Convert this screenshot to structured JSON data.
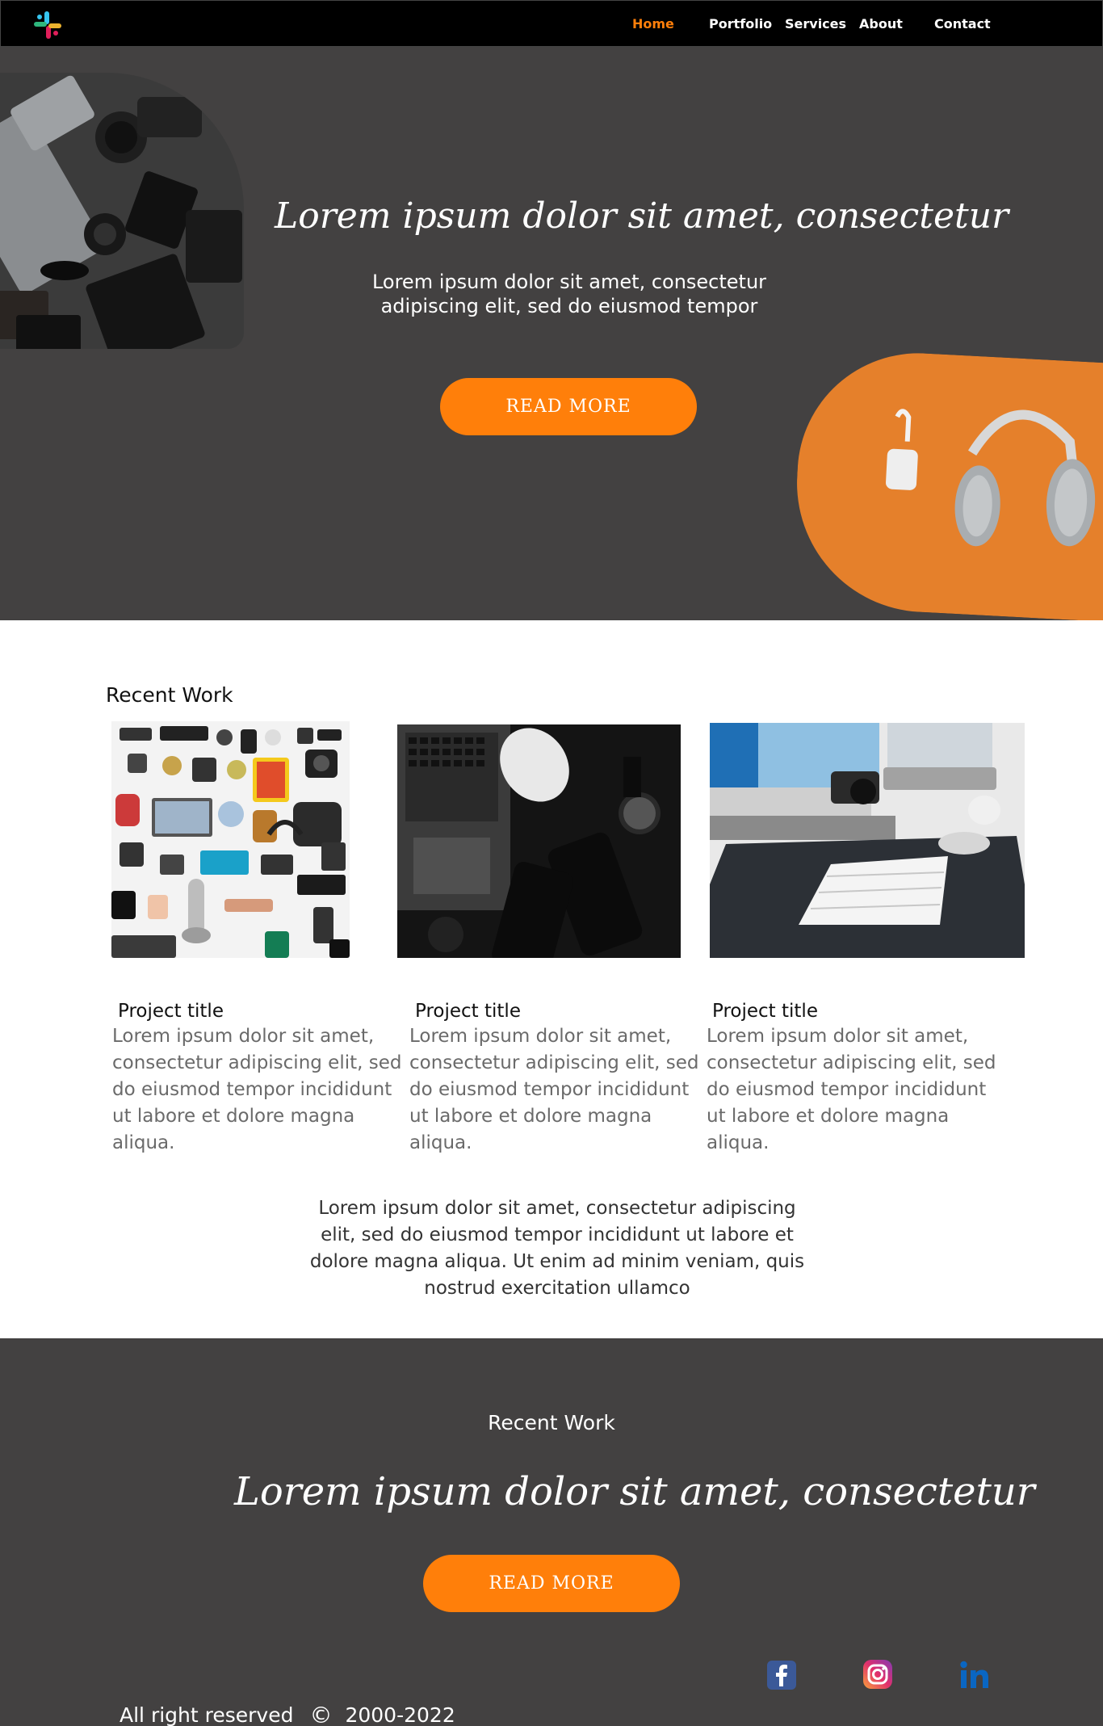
{
  "nav": {
    "items": [
      {
        "label": "Home",
        "active": true
      },
      {
        "label": "Portfolio",
        "active": false
      },
      {
        "label": "Services",
        "active": false
      },
      {
        "label": "About",
        "active": false
      },
      {
        "label": "Contact",
        "active": false
      }
    ]
  },
  "hero": {
    "title": "Lorem ipsum dolor sit amet, consectetur",
    "subtitle_line1": "Lorem ipsum dolor sit amet, consectetur",
    "subtitle_line2": "adipiscing elit, sed do eiusmod tempor",
    "button_label": "READ MORE"
  },
  "recent_work": {
    "heading": "Recent Work",
    "cards": [
      {
        "title": "Project title",
        "text": "Lorem ipsum dolor sit amet, consectetur adipiscing elit, sed do eiusmod tempor incididunt ut labore et dolore magna aliqua."
      },
      {
        "title": "Project title",
        "text": "Lorem ipsum dolor sit amet, consectetur adipiscing elit, sed do eiusmod tempor incididunt ut labore et dolore magna aliqua."
      },
      {
        "title": "Project title",
        "text": "Lorem ipsum dolor sit amet, consectetur adipiscing elit, sed do eiusmod tempor incididunt ut labore et dolore magna aliqua."
      }
    ],
    "paragraph": "Lorem ipsum dolor sit amet, consectetur adipiscing elit, sed do eiusmod tempor incididunt ut labore et dolore magna aliqua. Ut enim ad minim veniam, quis nostrud exercitation ullamco"
  },
  "footer": {
    "heading": "Recent Work",
    "title": "Lorem ipsum dolor sit amet, consectetur",
    "button_label": "READ MORE",
    "social": [
      "facebook-icon",
      "instagram-icon",
      "linkedin-icon"
    ],
    "copyright_text": "All right reserved",
    "copyright_symbol": "©",
    "copyright_years": "2000-2022"
  },
  "colors": {
    "accent": "#ff7f0a",
    "dark_bg": "#434141",
    "nav_bg": "#000000"
  }
}
